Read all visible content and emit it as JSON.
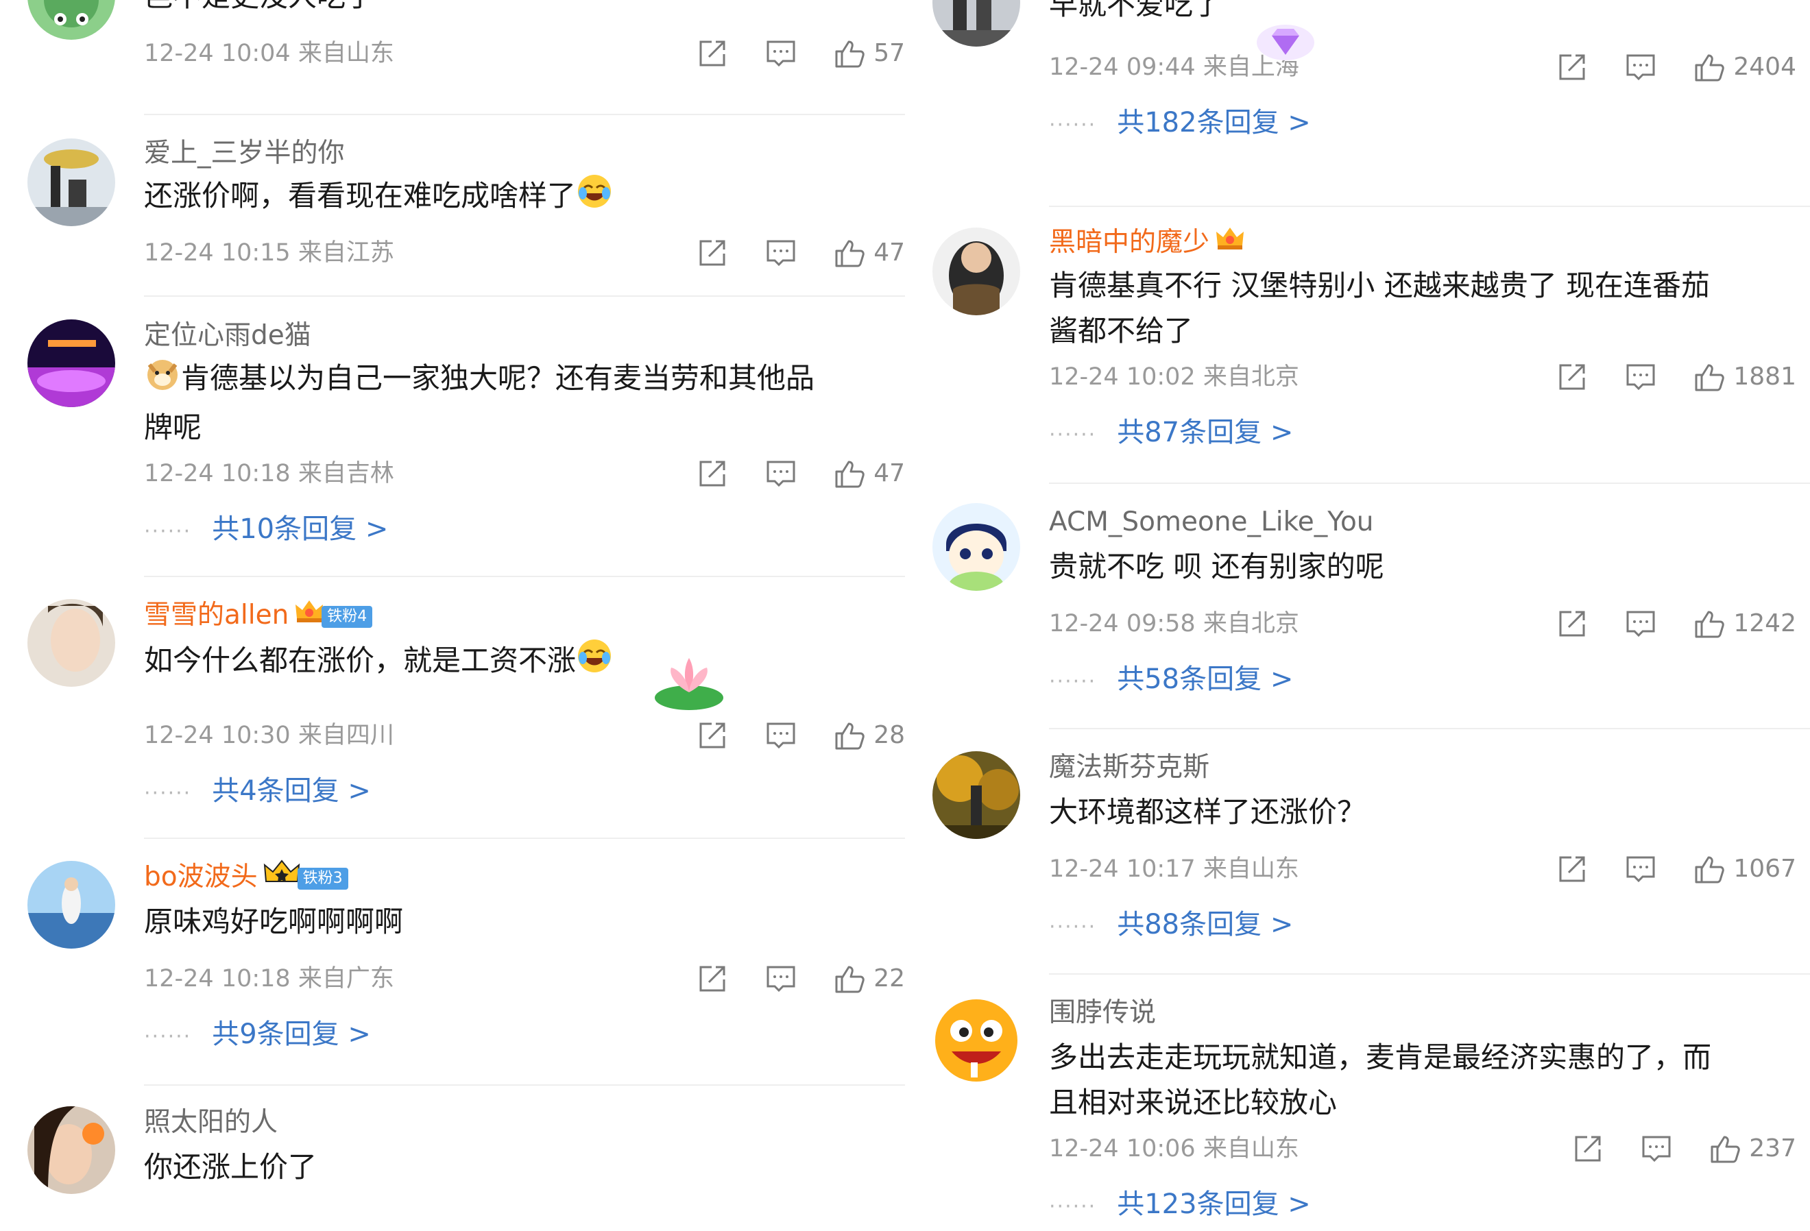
{
  "left": [
    {
      "text": "岂不是更没人吃了",
      "time": "12-24 10:04",
      "loc": "来自山东",
      "likes": "57"
    },
    {
      "name": "爱上_三岁半的你",
      "text": "还涨价啊，看看现在难吃成啥样了",
      "time": "12-24 10:15",
      "loc": "来自江苏",
      "likes": "47"
    },
    {
      "name": "定位心雨de猫",
      "text": "肯德基以为自己一家独大呢？还有麦当劳和其他品",
      "text2": "牌呢",
      "time": "12-24 10:18",
      "loc": "来自吉林",
      "likes": "47",
      "replies": "共10条回复 >"
    },
    {
      "name": "雪雪的allen",
      "badge": "铁粉4",
      "text": "如今什么都在涨价，就是工资不涨",
      "time": "12-24 10:30",
      "loc": "来自四川",
      "likes": "28",
      "replies": "共4条回复 >"
    },
    {
      "name": "bo波波头",
      "badge": "铁粉3",
      "text": "原味鸡好吃啊啊啊啊",
      "time": "12-24 10:18",
      "loc": "来自广东",
      "likes": "22",
      "replies": "共9条回复 >"
    },
    {
      "name": "照太阳的人",
      "text": "你还涨上价了"
    }
  ],
  "right": [
    {
      "text": "早就不爱吃了",
      "time": "12-24 09:44",
      "loc": "来自上海",
      "likes": "2404",
      "replies": "共182条回复 >"
    },
    {
      "name": "黑暗中的魔少",
      "text": "肯德基真不行  汉堡特别小  还越来越贵了  现在连番茄",
      "text2": "酱都不给了",
      "time": "12-24 10:02",
      "loc": "来自北京",
      "likes": "1881",
      "replies": "共87条回复 >"
    },
    {
      "name": "ACM_Someone_Like_You",
      "text": "贵就不吃 呗 还有别家的呢",
      "time": "12-24 09:58",
      "loc": "来自北京",
      "likes": "1242",
      "replies": "共58条回复 >"
    },
    {
      "name": "魔法斯芬克斯",
      "text": "大环境都这样了还涨价？",
      "time": "12-24 10:17",
      "loc": "来自山东",
      "likes": "1067",
      "replies": "共88条回复 >"
    },
    {
      "name": "围脖传说",
      "text": "多出去走走玩玩就知道，麦肯是最经济实惠的了，而",
      "text2": "且相对来说还比较放心",
      "time": "12-24 10:06",
      "loc": "来自山东",
      "likes": "237",
      "replies": "共123条回复 >"
    }
  ],
  "dots": "······",
  "colors": {
    "reply_link": "#3b77c7",
    "vip_name": "#f26a1b",
    "meta": "#9a9a9a"
  },
  "icons": [
    "share-icon",
    "comment-icon",
    "like-icon",
    "crown-icon",
    "laugh-emoji-icon",
    "doge-emoji-icon"
  ]
}
